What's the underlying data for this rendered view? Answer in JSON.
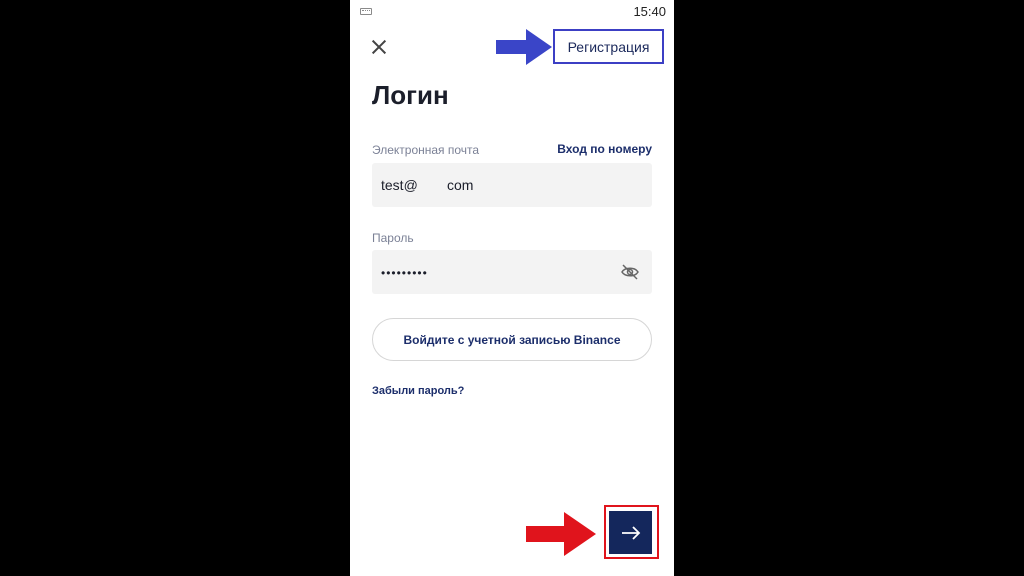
{
  "status_bar": {
    "time": "15:40",
    "keyboard_icon": "keyboard-icon"
  },
  "header": {
    "close_icon": "close-icon",
    "register_label": "Регистрация",
    "annotation_arrow_color": "#3a45c8",
    "annotation_frame_color": "#3c3fc4"
  },
  "form": {
    "title": "Логин",
    "email": {
      "label": "Электронная почта",
      "alt_link": "Вход по номеру",
      "value_start": "test@",
      "value_end": "com"
    },
    "password": {
      "label": "Пароль",
      "value": "•••••••••",
      "toggle_icon": "eye-off-icon"
    },
    "binance_label": "Войдите с учетной записью Binance",
    "forgot_label": "Забыли пароль?"
  },
  "footer": {
    "next_icon": "arrow-right-icon",
    "next_button_color": "#14275c",
    "annotation_arrow_color": "#e0141c",
    "annotation_frame_color": "#e0141c"
  }
}
